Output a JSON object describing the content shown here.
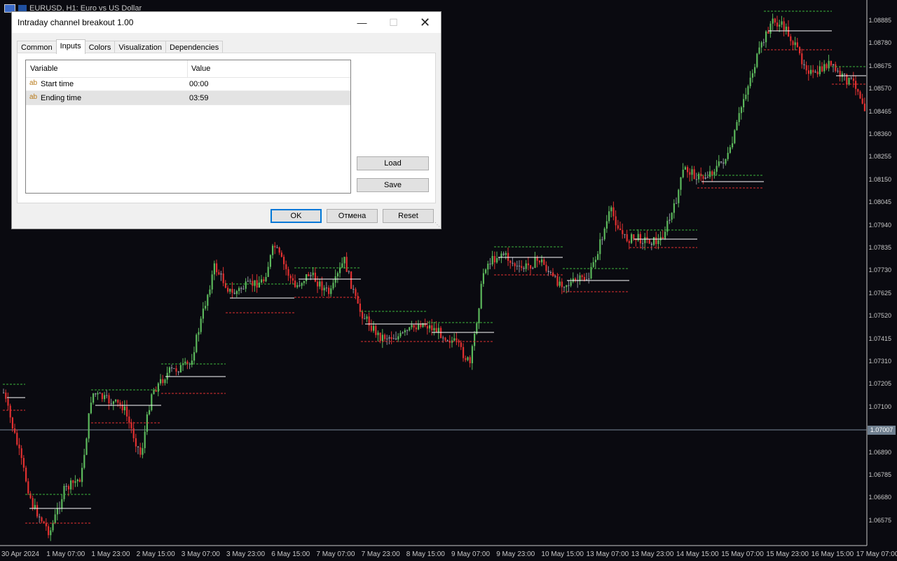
{
  "chart": {
    "symbol_title": "EURUSD, H1:  Euro vs US Dollar",
    "current_price": "1.07007",
    "price_labels": [
      "1.08885",
      "1.08780",
      "1.08675",
      "1.08570",
      "1.08465",
      "1.08360",
      "1.08255",
      "1.08150",
      "1.08045",
      "1.07940",
      "1.07835",
      "1.07730",
      "1.07625",
      "1.07520",
      "1.07415",
      "1.07310",
      "1.07205",
      "1.07100",
      "1.06890",
      "1.06785",
      "1.06680",
      "1.06575"
    ],
    "time_labels": [
      "30 Apr 2024",
      "1 May 07:00",
      "1 May 23:00",
      "2 May 15:00",
      "3 May 07:00",
      "3 May 23:00",
      "6 May 15:00",
      "7 May 07:00",
      "7 May 23:00",
      "8 May 15:00",
      "9 May 07:00",
      "9 May 23:00",
      "10 May 15:00",
      "13 May 07:00",
      "13 May 23:00",
      "14 May 15:00",
      "15 May 07:00",
      "15 May 23:00",
      "16 May 15:00",
      "17 May 07:00"
    ],
    "colors": {
      "bull": "#5cb85c",
      "bear": "#e03030",
      "neutral": "#9090a0",
      "channel_high": "#3cb43c",
      "channel_low": "#e03030",
      "mid": "#ffffff"
    }
  },
  "dialog": {
    "title": "Intraday channel breakout 1.00",
    "tabs": [
      "Common",
      "Inputs",
      "Colors",
      "Visualization",
      "Dependencies"
    ],
    "active_tab": "Inputs",
    "columns": {
      "variable": "Variable",
      "value": "Value"
    },
    "rows": [
      {
        "type_icon": "ab",
        "name": "Start time",
        "value": "00:00"
      },
      {
        "type_icon": "ab",
        "name": "Ending time",
        "value": "03:59"
      }
    ],
    "buttons": {
      "load": "Load",
      "save": "Save",
      "ok": "OK",
      "cancel": "Отмена",
      "reset": "Reset"
    }
  }
}
